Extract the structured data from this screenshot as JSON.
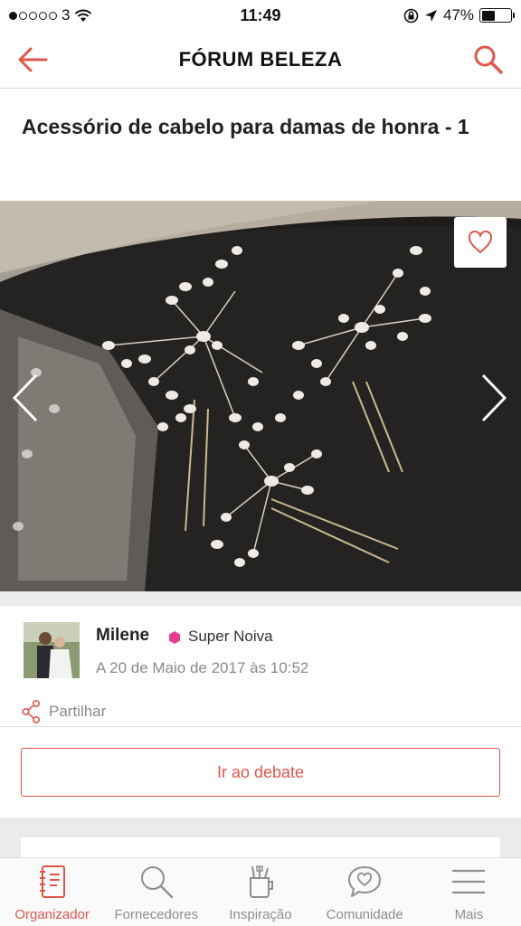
{
  "status_bar": {
    "carrier": "3",
    "signal_bars_filled": 1,
    "signal_bars_total": 5,
    "time": "11:49",
    "battery": "47%",
    "battery_level": 0.47
  },
  "nav": {
    "title": "FÓRUM BELEZA",
    "back_icon": "arrow-left-icon",
    "search_icon": "search-icon"
  },
  "post": {
    "title": "Acessório de cabelo para damas de honra - 1"
  },
  "author": {
    "name": "Milene",
    "badge": "Super Noiva",
    "badge_color": "#e93a8e",
    "date": "A 20 de Maio de 2017 às 10:52"
  },
  "share": {
    "label": "Partilhar"
  },
  "debate_button": {
    "label": "Ir ao debate"
  },
  "colors": {
    "accent": "#e0564d",
    "inactive": "#8e8e93"
  },
  "tabs": [
    {
      "label": "Organizador",
      "icon": "notebook-icon",
      "active": true
    },
    {
      "label": "Fornecedores",
      "icon": "search-icon",
      "active": false
    },
    {
      "label": "Inspiração",
      "icon": "inspiration-cup-icon",
      "active": false
    },
    {
      "label": "Comunidade",
      "icon": "chat-heart-icon",
      "active": false
    },
    {
      "label": "Mais",
      "icon": "menu-icon",
      "active": false
    }
  ]
}
